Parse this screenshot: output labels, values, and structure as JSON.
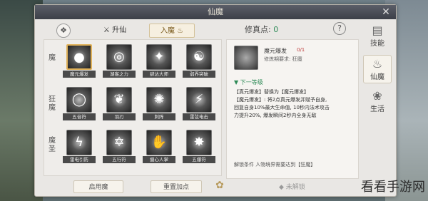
{
  "window": {
    "title": "仙魔",
    "close_icon": "close-icon"
  },
  "tabs": [
    {
      "label": "升仙",
      "icon": "blade-icon"
    },
    {
      "label": "入魔",
      "icon": "flame-icon",
      "active": true
    }
  ],
  "row_labels": [
    "魔",
    "狂魔",
    "魔圣"
  ],
  "skills": [
    {
      "label": "魔元爆发",
      "icon": "dark-orb-icon",
      "selected": true
    },
    {
      "label": "湖客之力",
      "icon": "swirl-icon"
    },
    {
      "label": "肆达大师",
      "icon": "claw-icon"
    },
    {
      "label": "弱界突破",
      "icon": "meditate-icon"
    },
    {
      "label": "五音符",
      "icon": "ring-icon"
    },
    {
      "label": "羽刃",
      "icon": "feather-icon"
    },
    {
      "label": "刺阵",
      "icon": "spiral-icon"
    },
    {
      "label": "雷弦电击",
      "icon": "slash-icon"
    },
    {
      "label": "雷电引防",
      "icon": "lightning-icon"
    },
    {
      "label": "五行符",
      "icon": "pentagram-icon"
    },
    {
      "label": "摄心人掌",
      "icon": "palm-icon"
    },
    {
      "label": "五爆符",
      "icon": "burst-icon"
    }
  ],
  "right_panel": {
    "points_label": "修真点:",
    "points_value": "0",
    "help_icon": "question-icon",
    "detail": {
      "name": "魔元爆发",
      "rank": "0/1",
      "requirement": "修炼期要求: 狂魔",
      "next_level": "▼ 下一等级",
      "desc_lines": [
        "【真元爆发】替换为【魔元爆发】",
        "【魔元爆发】: 将2点真元爆发并赋予自身,",
        "回复自身10%最大生命值, 10秒内法术攻击",
        "力提升20%, 爆发瞬间2秒内全身无敌"
      ],
      "unlock": "解锁条件  人物境界需要达到【狂魔】"
    }
  },
  "side_tabs": [
    {
      "label": "技能",
      "icon": "book-icon"
    },
    {
      "label": "仙魔",
      "icon": "flame-icon",
      "active": true
    },
    {
      "label": "生活",
      "icon": "lotus-icon"
    }
  ],
  "bottom": {
    "btn1": "启用魔",
    "btn2": "重置加点",
    "emblem_icon": "emblem-icon",
    "locked": "◆ 未解锁"
  },
  "watermark": "看看手游网"
}
